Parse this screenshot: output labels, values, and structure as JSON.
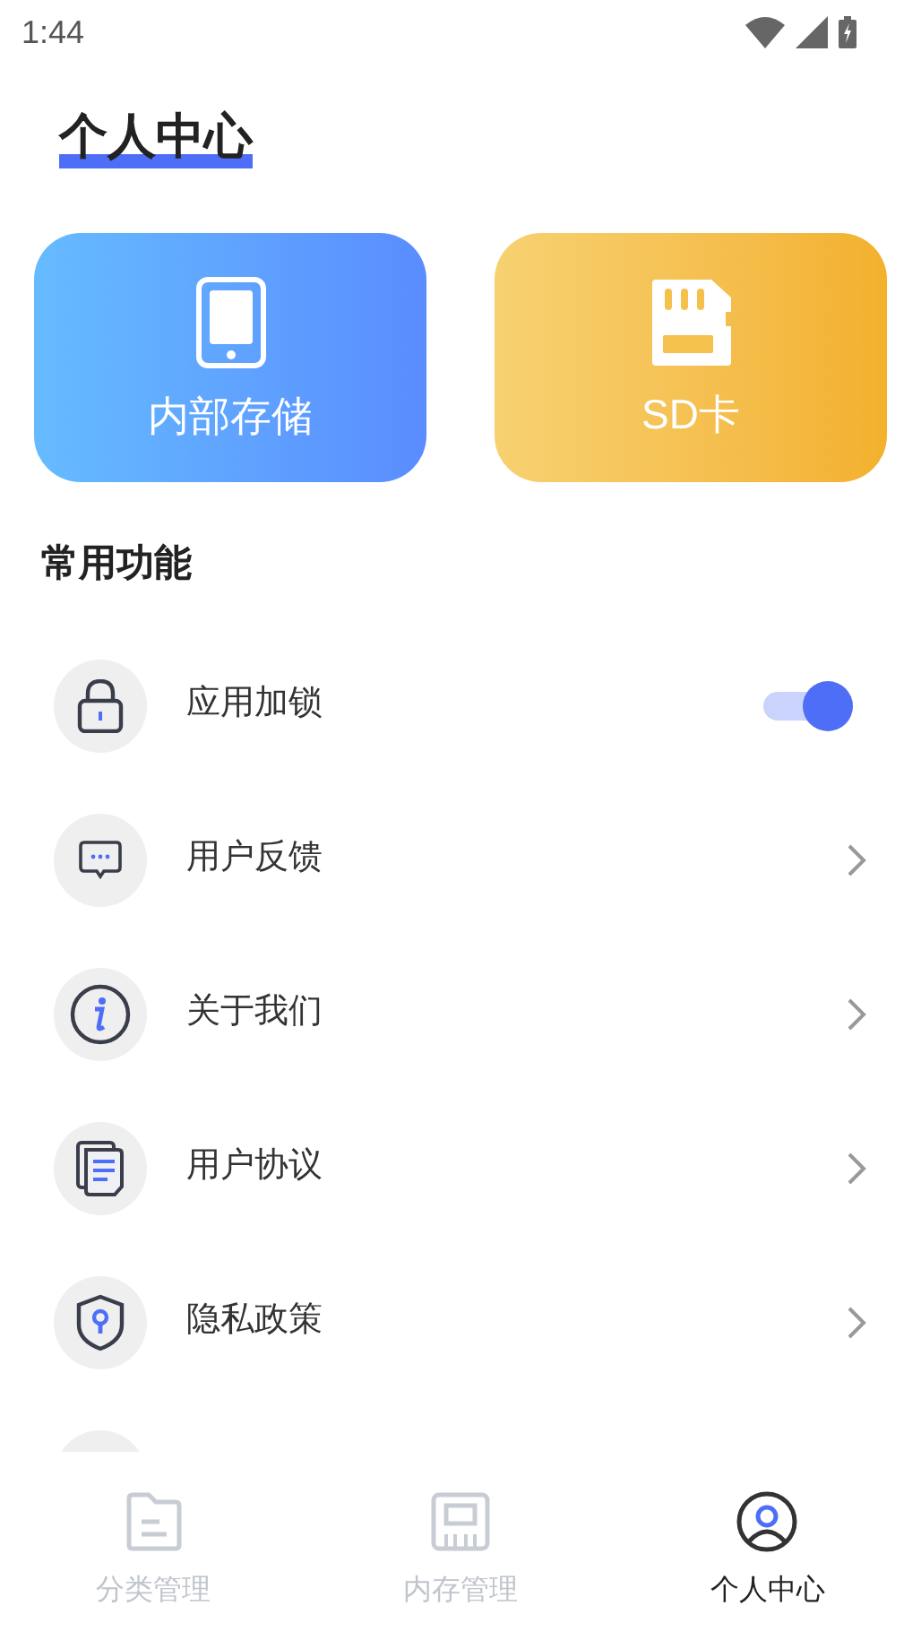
{
  "status_bar": {
    "time": "1:44"
  },
  "title": "个人中心",
  "storage_cards": [
    {
      "label": "内部存储"
    },
    {
      "label": "SD卡"
    }
  ],
  "section_title": "常用功能",
  "rows": [
    {
      "kind": "toggle",
      "label": "应用加锁",
      "on": true
    },
    {
      "kind": "link",
      "label": "用户反馈"
    },
    {
      "kind": "link",
      "label": "关于我们"
    },
    {
      "kind": "link",
      "label": "用户协议"
    },
    {
      "kind": "link",
      "label": "隐私政策"
    }
  ],
  "bottom_nav": [
    {
      "label": "分类管理",
      "selected": false
    },
    {
      "label": "内存管理",
      "selected": false
    },
    {
      "label": "个人中心",
      "selected": true
    }
  ]
}
